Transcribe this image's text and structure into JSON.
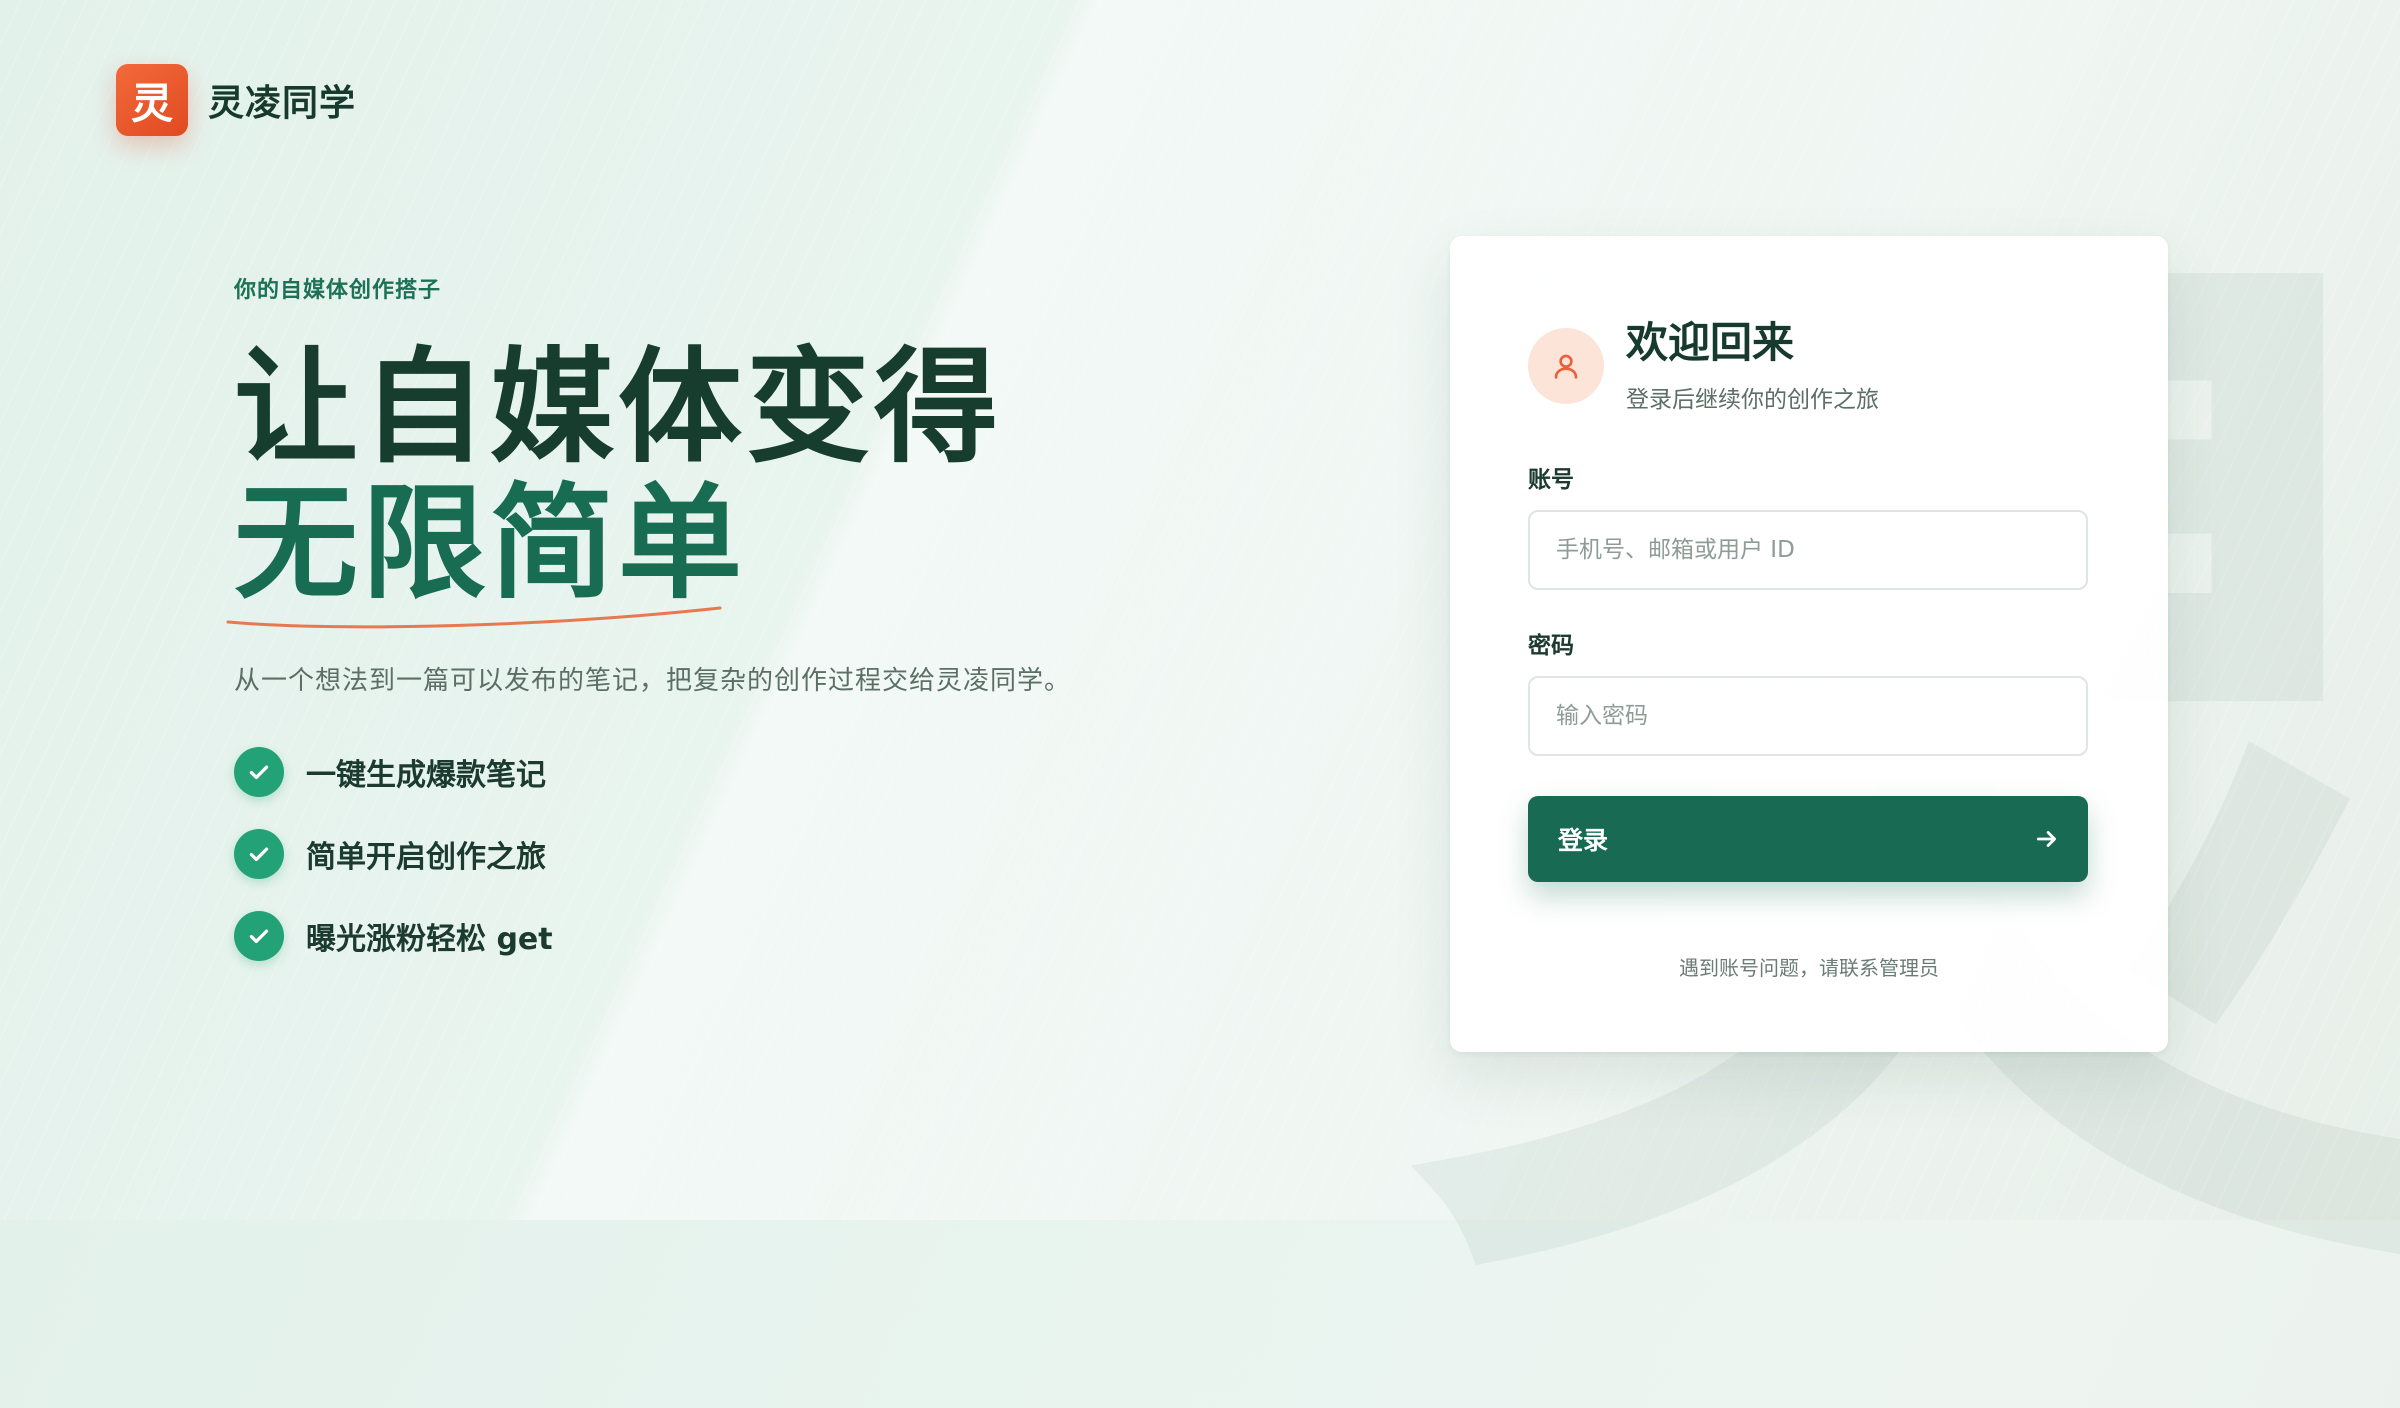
{
  "brand": {
    "logo_char": "灵",
    "name": "灵凌同学"
  },
  "hero": {
    "eyebrow": "你的自媒体创作搭子",
    "headline_line1": "让自媒体变得",
    "headline_line2": "无限简单",
    "subtitle": "从一个想法到一篇可以发布的笔记，把复杂的创作过程交给灵凌同学。",
    "features": [
      {
        "label": "一键生成爆款笔记",
        "icon": "check-icon"
      },
      {
        "label": "简单开启创作之旅",
        "icon": "check-icon"
      },
      {
        "label": "曝光涨粉轻松 get",
        "icon": "check-icon"
      }
    ]
  },
  "background": {
    "glyph": "灵"
  },
  "login": {
    "title": "欢迎回来",
    "subtitle": "登录后继续你的创作之旅",
    "account_label": "账号",
    "account_placeholder": "手机号、邮箱或用户 ID",
    "password_label": "密码",
    "password_placeholder": "输入密码",
    "submit_label": "登录",
    "help_text": "遇到账号问题，请联系管理员"
  },
  "colors": {
    "accent": "#186b52",
    "brand_orange": "#e14a22",
    "check_green": "#22a276",
    "avatar_bg": "#fde4d8"
  }
}
